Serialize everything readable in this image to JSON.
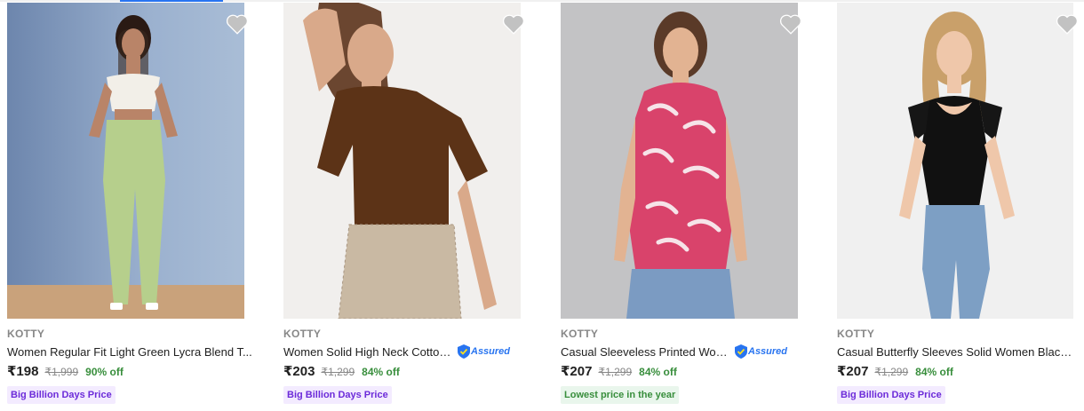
{
  "colors": {
    "accent": "#2874f0",
    "brand_text": "#878787",
    "discount": "#388e3c",
    "offer_tag_text": "#6c2bd9",
    "offer_tag_bg": "#f3ebff",
    "lowest_tag_text": "#388e3c",
    "lowest_tag_bg": "#e9f6ec",
    "wishlist_heart": "#c2c2c2"
  },
  "products": [
    {
      "brand": "KOTTY",
      "title": "Women Regular Fit Light Green Lycra Blend T...",
      "assured": false,
      "price": "₹198",
      "mrp": "₹1,999",
      "discount": "90% off",
      "tag": "Big Billion Days Price",
      "tag_style": "offer",
      "wishlist_icon": "heart-icon"
    },
    {
      "brand": "KOTTY",
      "title": "Women Solid High Neck Cotton ...",
      "assured": true,
      "assured_label": "Assured",
      "price": "₹203",
      "mrp": "₹1,299",
      "discount": "84% off",
      "tag": "Big Billion Days Price",
      "tag_style": "offer",
      "wishlist_icon": "heart-icon"
    },
    {
      "brand": "KOTTY",
      "title": "Casual Sleeveless Printed Wome...",
      "assured": true,
      "assured_label": "Assured",
      "price": "₹207",
      "mrp": "₹1,299",
      "discount": "84% off",
      "tag": "Lowest price in the year",
      "tag_style": "lowest",
      "wishlist_icon": "heart-icon"
    },
    {
      "brand": "KOTTY",
      "title": "Casual Butterfly Sleeves Solid Women Black ...",
      "assured": false,
      "price": "₹207",
      "mrp": "₹1,299",
      "discount": "84% off",
      "tag": "Big Billion Days Price",
      "tag_style": "offer",
      "wishlist_icon": "heart-icon"
    }
  ]
}
